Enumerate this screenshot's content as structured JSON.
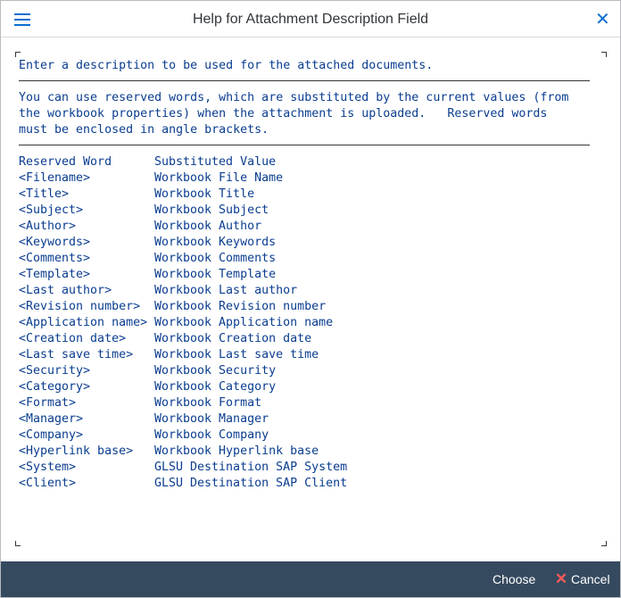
{
  "window": {
    "title": "Help for Attachment Description Field",
    "menu_icon": "hamburger-menu-icon",
    "close_icon": "close-icon"
  },
  "content": {
    "intro": "Enter a description to be used for the attached documents.",
    "explanation_lines": [
      "You can use reserved words, which are substituted by the current values (from",
      "the workbook properties) when the attachment is uploaded.   Reserved words",
      "must be enclosed in angle brackets."
    ],
    "table": {
      "header": {
        "col1": "Reserved Word",
        "col2": "Substituted Value"
      },
      "rows": [
        {
          "word": "<Filename>",
          "value": "Workbook File Name"
        },
        {
          "word": "<Title>",
          "value": "Workbook Title"
        },
        {
          "word": "<Subject>",
          "value": "Workbook Subject"
        },
        {
          "word": "<Author>",
          "value": "Workbook Author"
        },
        {
          "word": "<Keywords>",
          "value": "Workbook Keywords"
        },
        {
          "word": "<Comments>",
          "value": "Workbook Comments"
        },
        {
          "word": "<Template>",
          "value": "Workbook Template"
        },
        {
          "word": "<Last author>",
          "value": "Workbook Last author"
        },
        {
          "word": "<Revision number>",
          "value": "Workbook Revision number"
        },
        {
          "word": "<Application name>",
          "value": "Workbook Application name"
        },
        {
          "word": "<Creation date>",
          "value": "Workbook Creation date"
        },
        {
          "word": "<Last save time>",
          "value": "Workbook Last save time"
        },
        {
          "word": "<Security>",
          "value": "Workbook Security"
        },
        {
          "word": "<Category>",
          "value": "Workbook Category"
        },
        {
          "word": "<Format>",
          "value": "Workbook Format"
        },
        {
          "word": "<Manager>",
          "value": "Workbook Manager"
        },
        {
          "word": "<Company>",
          "value": "Workbook Company"
        },
        {
          "word": "<Hyperlink base>",
          "value": "Workbook Hyperlink base"
        },
        {
          "word": "<System>",
          "value": "GLSU Destination SAP System"
        },
        {
          "word": "<Client>",
          "value": "GLSU Destination SAP Client"
        }
      ]
    }
  },
  "footer": {
    "choose_label": "Choose",
    "cancel_label": "Cancel",
    "cancel_icon": "cancel-x-icon"
  },
  "colors": {
    "accent": "#0a6ed1",
    "footer_bg": "#354a5f",
    "text_mono": "#0a3d8f",
    "cancel_icon": "#ff5a5a"
  }
}
